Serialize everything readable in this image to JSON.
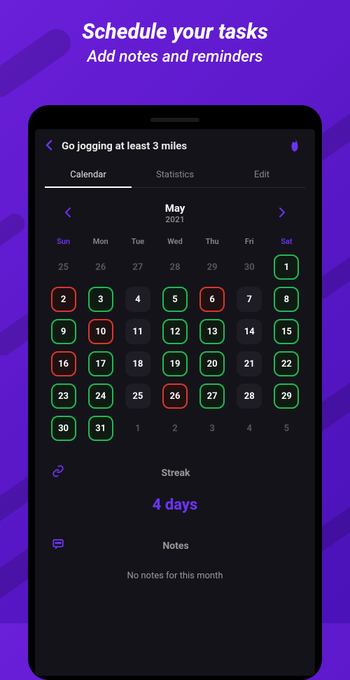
{
  "hero": {
    "title": "Schedule your tasks",
    "subtitle": "Add notes and reminders"
  },
  "header": {
    "task_title": "Go jogging at least 3 miles"
  },
  "tabs": {
    "calendar": "Calendar",
    "statistics": "Statistics",
    "edit": "Edit"
  },
  "calendar": {
    "month": "May",
    "year": "2021",
    "weekdays": [
      "Sun",
      "Mon",
      "Tue",
      "Wed",
      "Thu",
      "Fri",
      "Sat"
    ],
    "days": [
      {
        "n": 25,
        "s": "faded"
      },
      {
        "n": 26,
        "s": "faded"
      },
      {
        "n": 27,
        "s": "faded"
      },
      {
        "n": 28,
        "s": "faded"
      },
      {
        "n": 29,
        "s": "faded"
      },
      {
        "n": 30,
        "s": "faded"
      },
      {
        "n": 1,
        "s": "green"
      },
      {
        "n": 2,
        "s": "red"
      },
      {
        "n": 3,
        "s": "green"
      },
      {
        "n": 4,
        "s": "plain"
      },
      {
        "n": 5,
        "s": "green"
      },
      {
        "n": 6,
        "s": "red"
      },
      {
        "n": 7,
        "s": "plain"
      },
      {
        "n": 8,
        "s": "green"
      },
      {
        "n": 9,
        "s": "green"
      },
      {
        "n": 10,
        "s": "red"
      },
      {
        "n": 11,
        "s": "plain"
      },
      {
        "n": 12,
        "s": "green"
      },
      {
        "n": 13,
        "s": "green"
      },
      {
        "n": 14,
        "s": "plain"
      },
      {
        "n": 15,
        "s": "green"
      },
      {
        "n": 16,
        "s": "red"
      },
      {
        "n": 17,
        "s": "green"
      },
      {
        "n": 18,
        "s": "plain"
      },
      {
        "n": 19,
        "s": "green"
      },
      {
        "n": 20,
        "s": "green"
      },
      {
        "n": 21,
        "s": "plain"
      },
      {
        "n": 22,
        "s": "green"
      },
      {
        "n": 23,
        "s": "green"
      },
      {
        "n": 24,
        "s": "green"
      },
      {
        "n": 25,
        "s": "plain"
      },
      {
        "n": 26,
        "s": "red"
      },
      {
        "n": 27,
        "s": "green"
      },
      {
        "n": 28,
        "s": "plain"
      },
      {
        "n": 29,
        "s": "green"
      },
      {
        "n": 30,
        "s": "green"
      },
      {
        "n": 31,
        "s": "green"
      },
      {
        "n": 1,
        "s": "faded"
      },
      {
        "n": 2,
        "s": "faded"
      },
      {
        "n": 3,
        "s": "faded"
      },
      {
        "n": 4,
        "s": "faded"
      },
      {
        "n": 5,
        "s": "faded"
      }
    ]
  },
  "streak": {
    "label": "Streak",
    "value": "4 days"
  },
  "notes": {
    "label": "Notes",
    "empty": "No notes for this month"
  }
}
